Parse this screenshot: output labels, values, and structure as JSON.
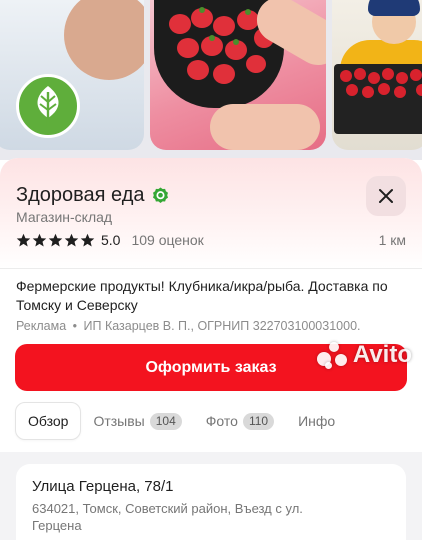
{
  "shop": {
    "title": "Здоровая еда",
    "subtitle": "Магазин-склад",
    "rating": "5.0",
    "reviews": "109 оценок",
    "stars": 5,
    "distance": "1 км",
    "description": "Фермерские продукты! Клубника/икра/рыба. Доставка по Томску и Северску",
    "ad_label": "Реклама",
    "ad_separator": "•",
    "ad_owner": "ИП Казарцев В. П., ОГРНИП 322703100031000."
  },
  "order_button": {
    "label": "Оформить заказ"
  },
  "tabs": [
    {
      "label": "Обзор",
      "count": ""
    },
    {
      "label": "Отзывы",
      "count": "104"
    },
    {
      "label": "Фото",
      "count": "110"
    },
    {
      "label": "Инфо",
      "count": ""
    }
  ],
  "address": {
    "street": "Улица Герцена, 78/1",
    "detail": "634021, Томск, Советский район, Въезд с ул. Герцена"
  },
  "watermark": {
    "text": "Avito"
  },
  "icons": {
    "close": "close-icon",
    "verified": "verified-check-icon",
    "star": "star-icon",
    "logo": "leaf-logo"
  },
  "colors": {
    "accent": "#f3131f",
    "verified": "#35a735",
    "star": "#1f1f1f",
    "card_tint": "#fde3e4"
  }
}
